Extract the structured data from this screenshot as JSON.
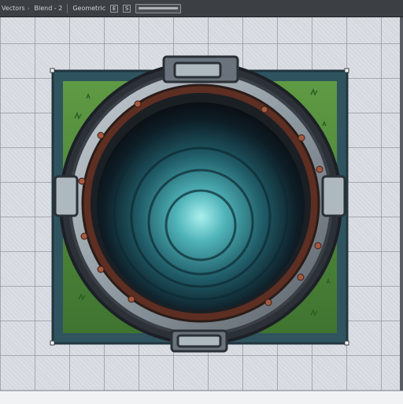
{
  "toolbar": {
    "items": [
      {
        "label": "Vectors"
      },
      {
        "label": "Blend - 2"
      },
      {
        "label": "Geometric"
      }
    ],
    "chevron": "›",
    "square_icons": [
      "E",
      "S"
    ],
    "field_icon": "slider-field-icon"
  },
  "colors": {
    "toolbar": "#3c3f43",
    "canvas": "#d5d9df",
    "grass": "#4f8a3a",
    "rim_metal": "#8f9aa2",
    "portal_glow": "#7fd6d8"
  }
}
